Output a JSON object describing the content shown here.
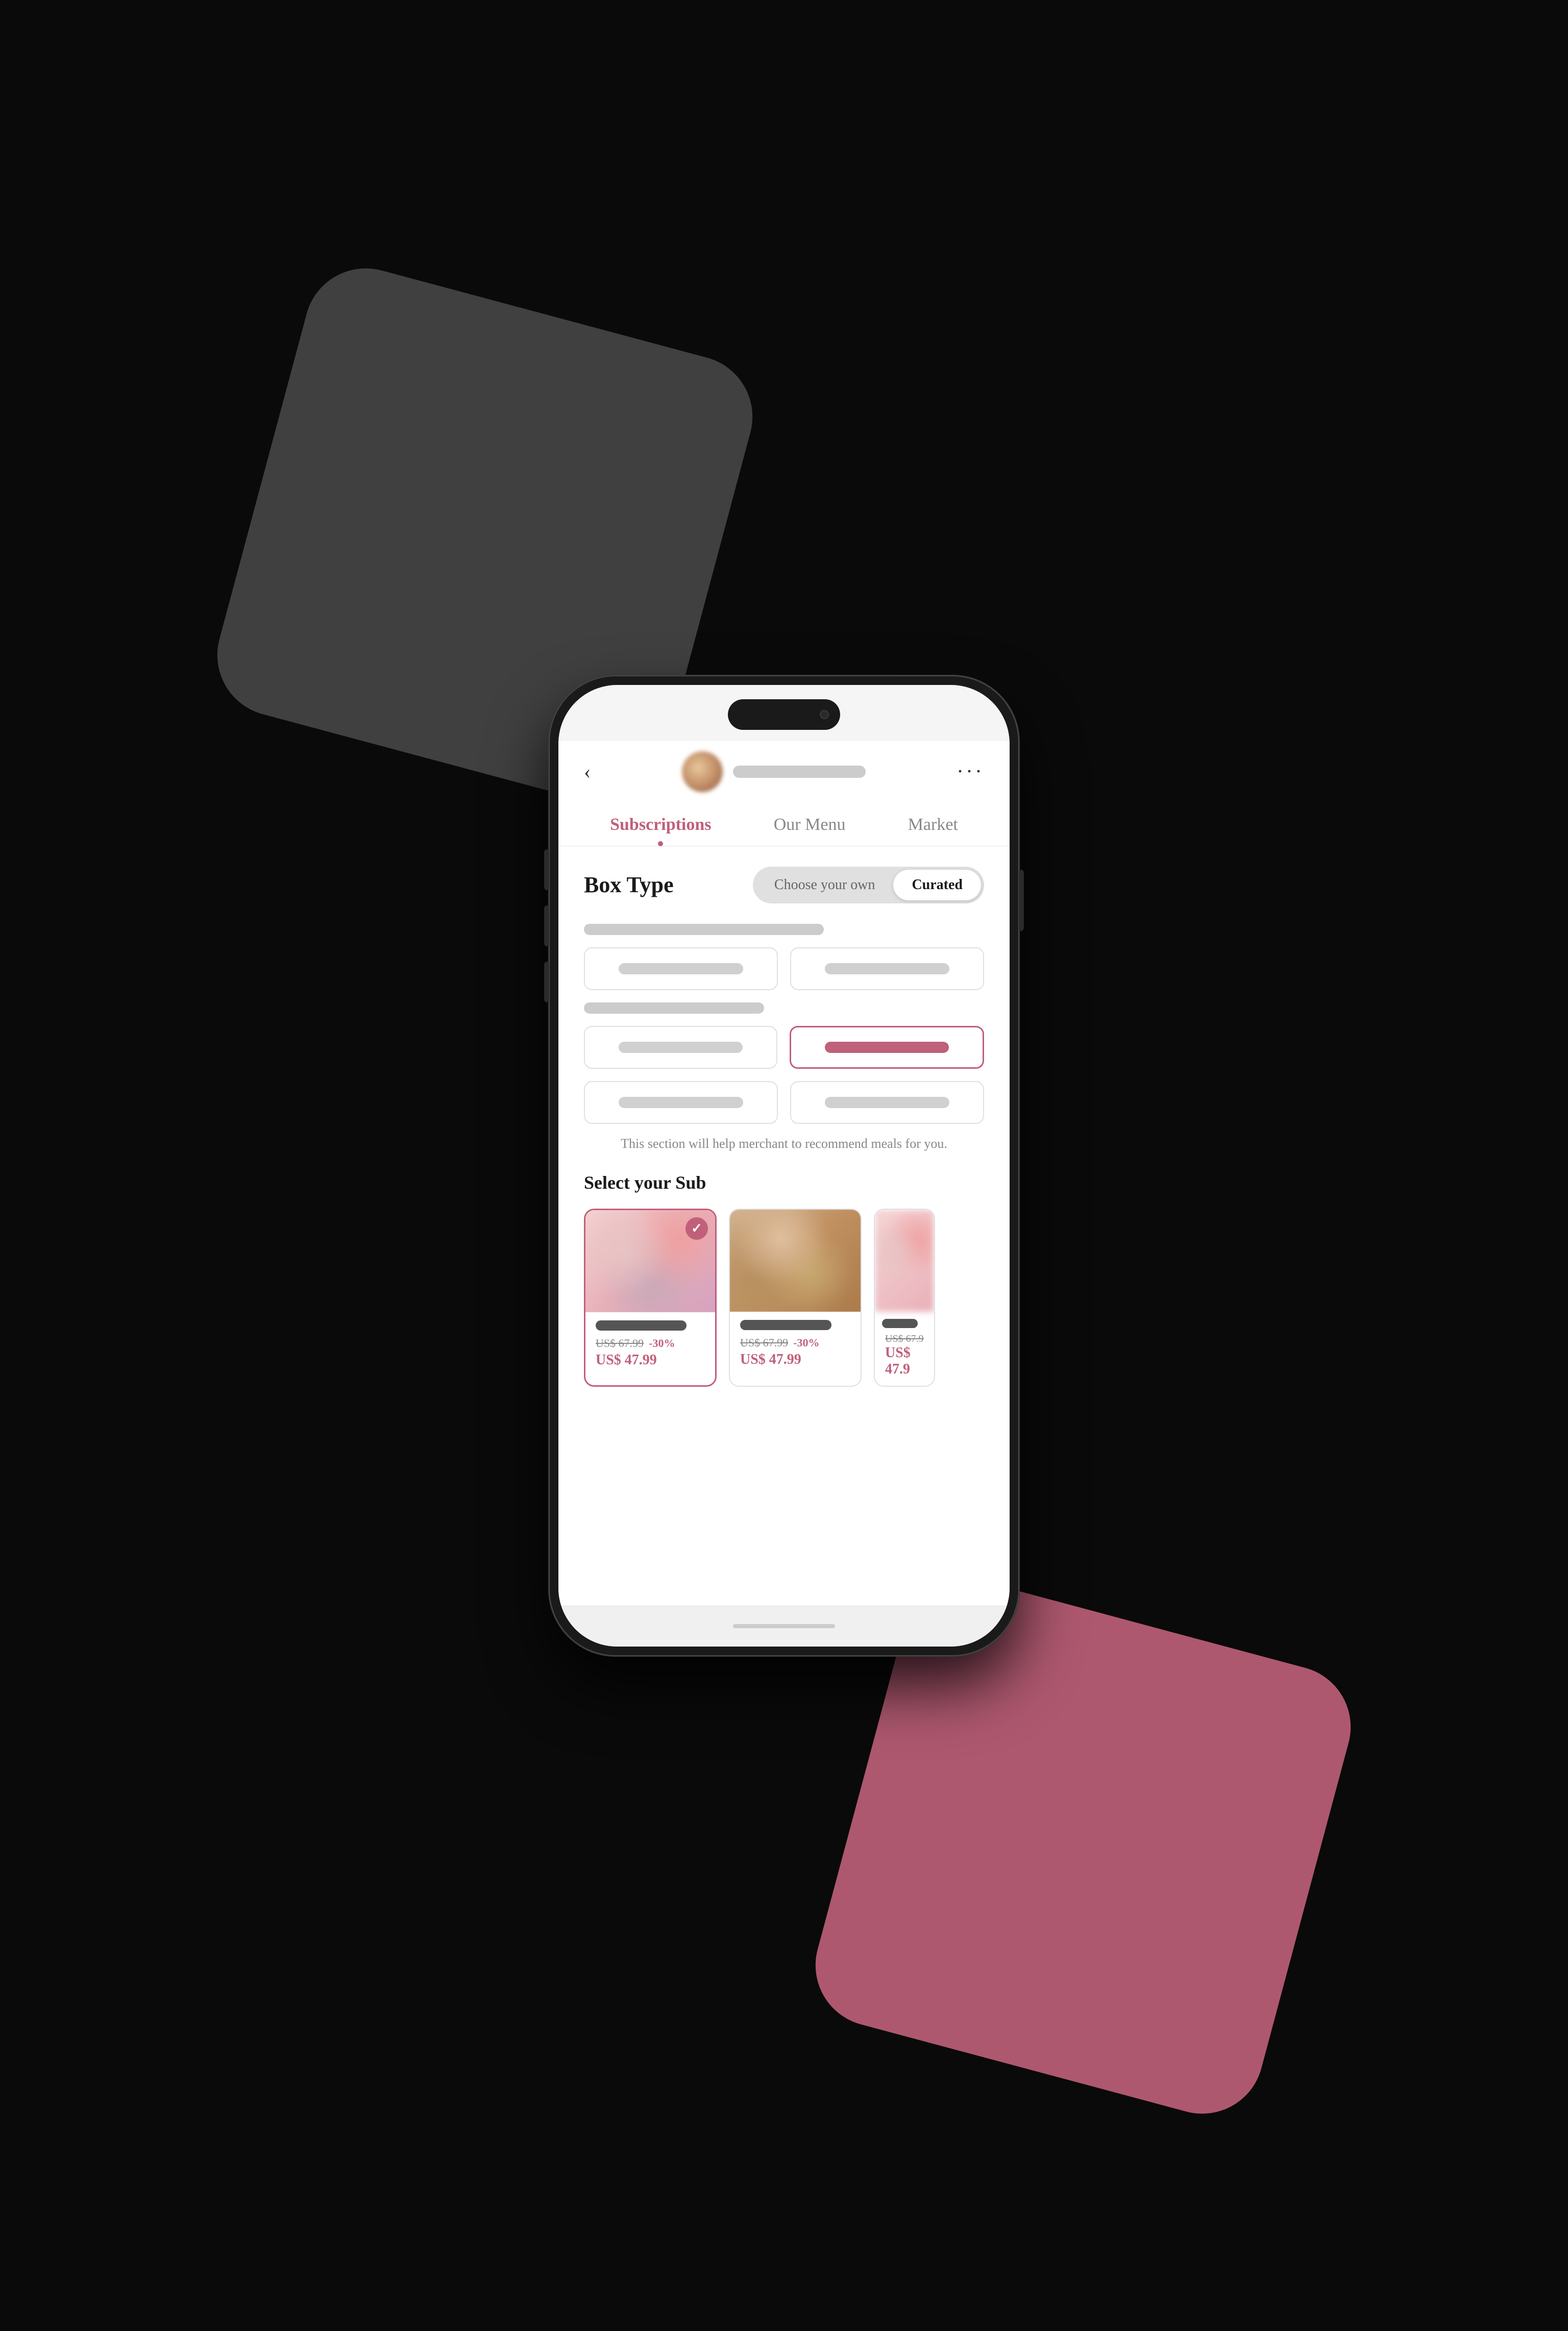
{
  "background": {
    "gray_shape_color": "#4a4a4a",
    "pink_shape_color": "#c0607a"
  },
  "header": {
    "back_label": "‹",
    "menu_label": "···",
    "title_bar_placeholder": ""
  },
  "nav": {
    "tabs": [
      {
        "label": "Subscriptions",
        "active": true
      },
      {
        "label": "Our Menu",
        "active": false
      },
      {
        "label": "Market",
        "active": false
      }
    ]
  },
  "box_type": {
    "label": "Box Type",
    "toggle": {
      "options": [
        {
          "label": "Choose your own",
          "active": false
        },
        {
          "label": "Curated",
          "active": true
        }
      ]
    }
  },
  "filters": {
    "help_text": "This section will help merchant to recommend meals for you.",
    "rows": [
      {
        "label_bar": true,
        "buttons": [
          {
            "label": "",
            "selected": false
          },
          {
            "label": "",
            "selected": false
          }
        ]
      },
      {
        "label_bar": true,
        "buttons": [
          {
            "label": "",
            "selected": false
          },
          {
            "label": "",
            "selected": true
          }
        ]
      },
      {
        "label_bar": false,
        "buttons": [
          {
            "label": "",
            "selected": false
          },
          {
            "label": "",
            "selected": false
          }
        ]
      }
    ]
  },
  "select_sub": {
    "title": "Select your Sub",
    "cards": [
      {
        "selected": true,
        "price_original": "US$ 67.99",
        "discount": "-30%",
        "price_current": "US$ 47.99"
      },
      {
        "selected": false,
        "price_original": "US$ 67.99",
        "discount": "-30%",
        "price_current": "US$ 47.99"
      },
      {
        "selected": false,
        "price_original": "US$ 67.9",
        "price_current": "US$ 47.9"
      }
    ]
  }
}
